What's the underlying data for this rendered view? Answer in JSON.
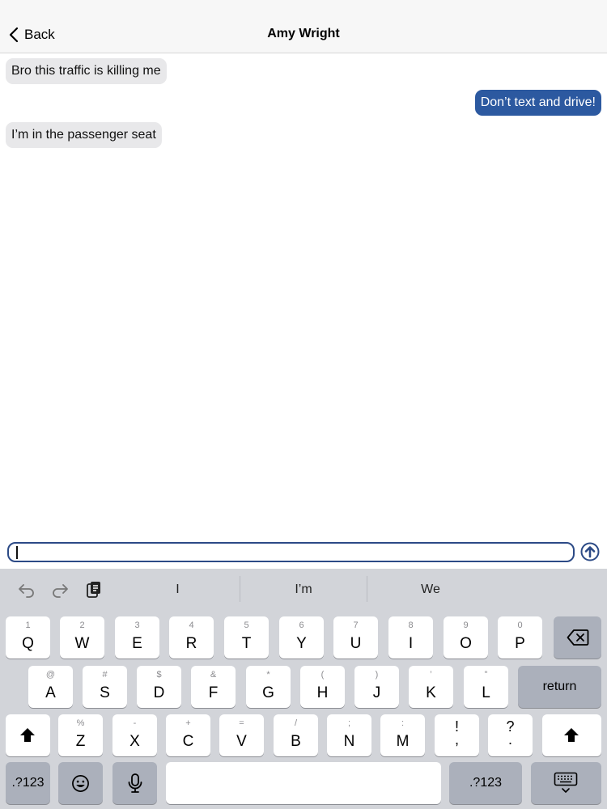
{
  "header": {
    "back_label": "Back",
    "title": "Amy Wright"
  },
  "messages": [
    {
      "direction": "incoming",
      "text": "Bro this traffic is killing me"
    },
    {
      "direction": "outgoing",
      "text": "Don’t text and drive!"
    },
    {
      "direction": "incoming",
      "text": "I’m in the passenger seat"
    }
  ],
  "composer": {
    "value": "",
    "send_icon": "arrow-up-circle-icon"
  },
  "keyboard": {
    "toolbar_icons": [
      "undo-icon",
      "redo-icon",
      "paste-icon"
    ],
    "suggestions": [
      "I",
      "I’m",
      "We"
    ],
    "row1": [
      {
        "main": "Q",
        "alt": "1"
      },
      {
        "main": "W",
        "alt": "2"
      },
      {
        "main": "E",
        "alt": "3"
      },
      {
        "main": "R",
        "alt": "4"
      },
      {
        "main": "T",
        "alt": "5"
      },
      {
        "main": "Y",
        "alt": "6"
      },
      {
        "main": "U",
        "alt": "7"
      },
      {
        "main": "I",
        "alt": "8"
      },
      {
        "main": "O",
        "alt": "9"
      },
      {
        "main": "P",
        "alt": "0"
      }
    ],
    "row2": [
      {
        "main": "A",
        "alt": "@"
      },
      {
        "main": "S",
        "alt": "#"
      },
      {
        "main": "D",
        "alt": "$"
      },
      {
        "main": "F",
        "alt": "&"
      },
      {
        "main": "G",
        "alt": "*"
      },
      {
        "main": "H",
        "alt": "("
      },
      {
        "main": "J",
        "alt": ")"
      },
      {
        "main": "K",
        "alt": "’"
      },
      {
        "main": "L",
        "alt": "\""
      }
    ],
    "row3": [
      {
        "main": "Z",
        "alt": "%"
      },
      {
        "main": "X",
        "alt": "-"
      },
      {
        "main": "C",
        "alt": "+"
      },
      {
        "main": "V",
        "alt": "="
      },
      {
        "main": "B",
        "alt": "/"
      },
      {
        "main": "N",
        "alt": ";"
      },
      {
        "main": "M",
        "alt": ":"
      }
    ],
    "punct": [
      {
        "top": "!",
        "bottom": ","
      },
      {
        "top": "?",
        "bottom": "."
      }
    ],
    "return_label": "return",
    "numbers_label": ".?123",
    "icons": {
      "delete": "delete-icon",
      "shift": "shift-icon",
      "emoji": "emoji-icon",
      "mic": "microphone-icon",
      "hide": "hide-keyboard-icon"
    }
  }
}
